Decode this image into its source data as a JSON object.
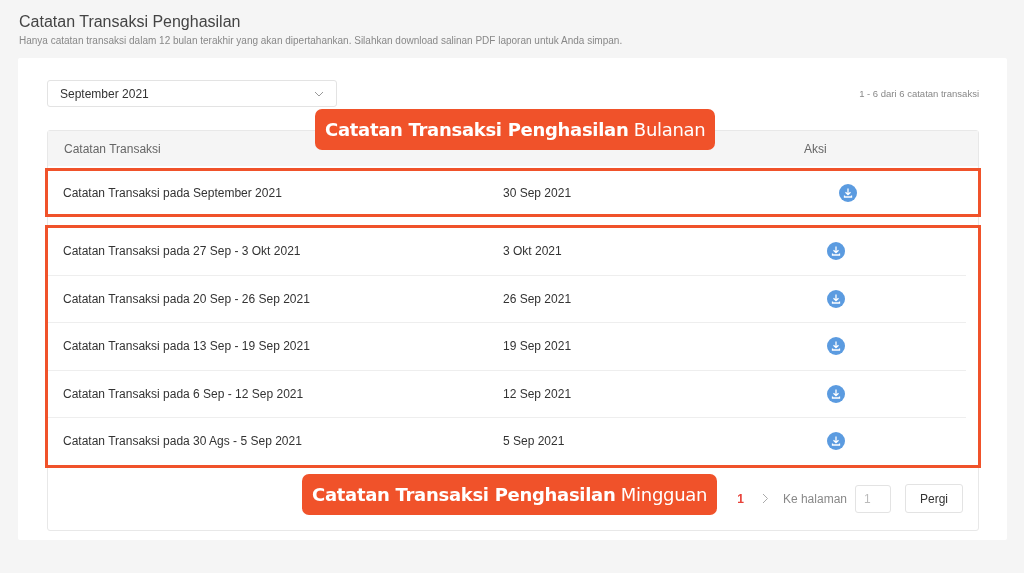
{
  "header": {
    "title": "Catatan Transaksi Penghasilan",
    "subtitle": "Hanya catatan transaksi dalam 12 bulan terakhir yang akan dipertahankan. Silahkan download salinan PDF laporan untuk Anda simpan."
  },
  "period_select": {
    "value": "September 2021"
  },
  "record_count": "1 - 6 dari 6 catatan transaksi",
  "table": {
    "columns": [
      {
        "label": "Catatan Transaksi"
      },
      {
        "label": "Aksi"
      }
    ],
    "groups": [
      {
        "callout": {
          "bold": "Catatan Transaksi Penghasilan",
          "rest": "Bulanan"
        },
        "rows": [
          {
            "name": "Catatan Transaksi pada September 2021",
            "date": "30 Sep 2021"
          }
        ]
      },
      {
        "callout": {
          "bold": "Catatan Transaksi Penghasilan",
          "rest": "Mingguan"
        },
        "rows": [
          {
            "name": "Catatan Transaksi pada 27 Sep - 3 Okt 2021",
            "date": "3 Okt 2021"
          },
          {
            "name": "Catatan Transaksi pada 20 Sep - 26 Sep 2021",
            "date": "26 Sep 2021"
          },
          {
            "name": "Catatan Transaksi pada 13 Sep - 19 Sep 2021",
            "date": "19 Sep 2021"
          },
          {
            "name": "Catatan Transaksi pada 6 Sep - 12 Sep 2021",
            "date": "12 Sep 2021"
          },
          {
            "name": "Catatan Transaksi pada 30 Ags - 5 Sep 2021",
            "date": "5 Sep 2021"
          }
        ]
      }
    ]
  },
  "pagination": {
    "pages": [
      {
        "label": "1",
        "selected": true
      }
    ],
    "goto_label": "Ke halaman",
    "goto_placeholder": "1",
    "goto_button": "Pergi"
  }
}
